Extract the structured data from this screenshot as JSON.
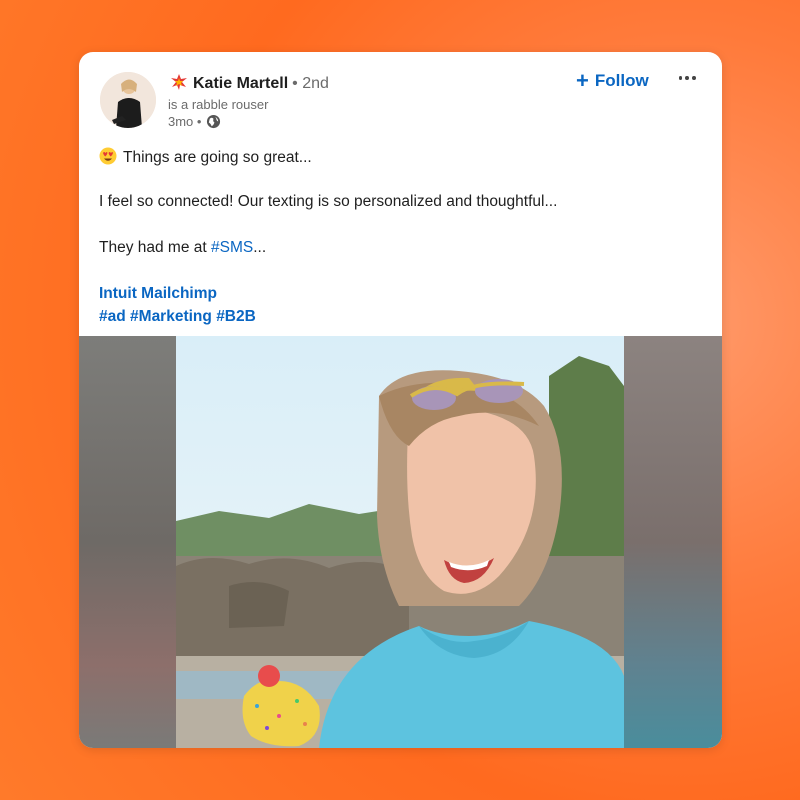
{
  "post": {
    "author": {
      "name": "Katie Martell",
      "name_icon": "collision-emoji-icon",
      "degree": "• 2nd",
      "headline": "is a rabble rouser",
      "time": "3mo •",
      "visibility_icon": "globe-icon"
    },
    "follow_label": "Follow",
    "body": {
      "line1_emoji": "heart-eyes-emoji-icon",
      "line1": "Things are going so great...",
      "line2": "I feel so connected! Our texting is so personalized and thoughtful...",
      "line3_prefix": "They had me at ",
      "line3_hashtag": "#SMS",
      "line3_suffix": "...",
      "mention": "Intuit Mailchimp",
      "hashtags": [
        "#ad",
        "#Marketing",
        "#B2B"
      ]
    }
  },
  "colors": {
    "link": "#0a66c2",
    "background_orange": "#ff6a1f"
  }
}
